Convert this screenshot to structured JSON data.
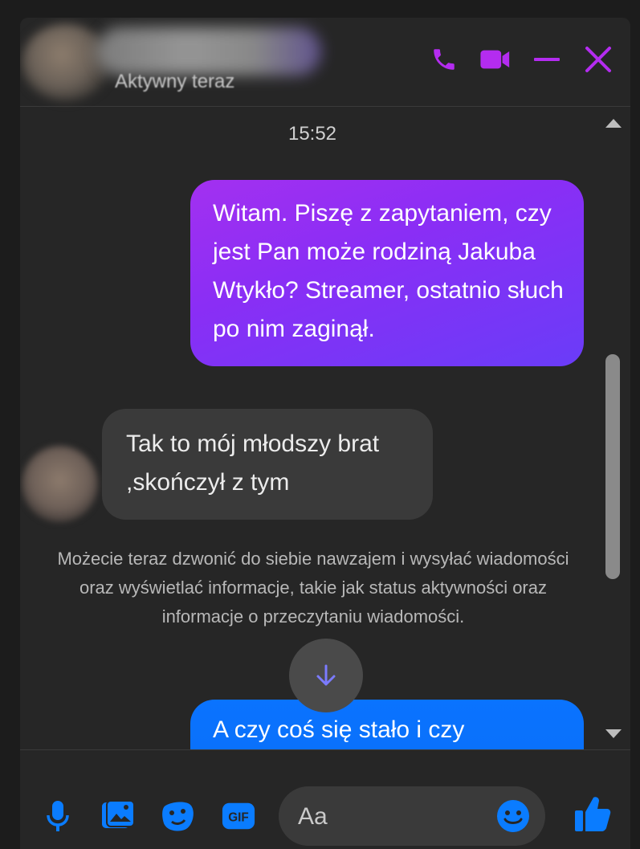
{
  "header": {
    "status": "Aktywny teraz",
    "icons": [
      "phone-icon",
      "video-icon",
      "minimize-icon",
      "close-icon"
    ],
    "accent_color": "#b42cf0"
  },
  "messages": {
    "timestamp": "15:52",
    "outgoing_1": "Witam. Piszę z zapytaniem, czy jest Pan może rodziną Jakuba Wtykło? Streamer, ostatnio słuch po nim zaginął.",
    "incoming_1": "Tak to mój młodszy brat ,skończył z tym",
    "notice": "Możecie teraz dzwonić do siebie nawzajem i wysyłać wiadomości oraz wyświetlać informacje, takie jak status aktywności oraz informacje o przeczytaniu wiadomości.",
    "outgoing_2": "A czy coś się stało i czy"
  },
  "composer": {
    "placeholder": "Aa",
    "icons": [
      "microphone-icon",
      "image-icon",
      "sticker-icon",
      "gif-icon",
      "emoji-icon",
      "thumbs-up-icon"
    ],
    "accent_color": "#0a7cff"
  }
}
